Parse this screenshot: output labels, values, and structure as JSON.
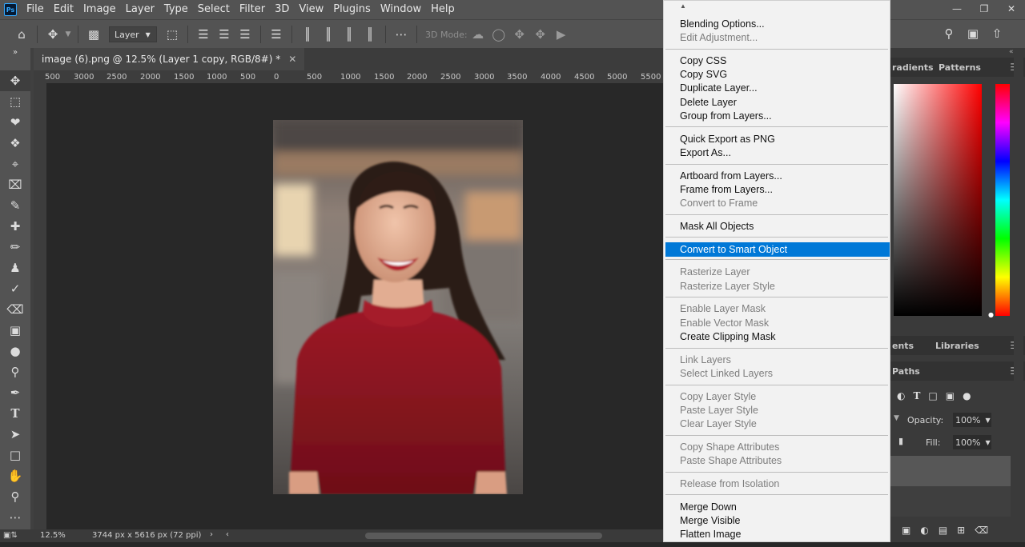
{
  "app": {
    "logo_text": "Ps"
  },
  "menubar": {
    "items": [
      "File",
      "Edit",
      "Image",
      "Layer",
      "Type",
      "Select",
      "Filter",
      "3D",
      "View",
      "Plugins",
      "Window",
      "Help"
    ]
  },
  "options": {
    "layer_select": "Layer",
    "three_d_label": "3D Mode:"
  },
  "document": {
    "tab_title": "image (6).png @ 12.5% (Layer 1 copy, RGB/8#) *"
  },
  "ruler": {
    "ticks": [
      "500",
      "3000",
      "2500",
      "2000",
      "1500",
      "1000",
      "500",
      "0",
      "500",
      "1000",
      "1500",
      "2000",
      "2500",
      "3000",
      "3500",
      "4000",
      "4500",
      "5000",
      "5500"
    ]
  },
  "status": {
    "zoom": "12.5%",
    "doc_info": "3744 px x 5616 px (72 ppi)"
  },
  "panels": {
    "color_tabs": [
      "radients",
      "Patterns"
    ],
    "mid_tabs": [
      "ents",
      "Libraries"
    ],
    "layers_tab": "Paths",
    "opacity_label": "Opacity:",
    "opacity_value": "100%",
    "fill_label": "Fill:",
    "fill_value": "100%"
  },
  "context_menu": {
    "highlighted": "Convert to Smart Object",
    "groups": [
      [
        {
          "label": "Blending Options...",
          "enabled": true
        },
        {
          "label": "Edit Adjustment...",
          "enabled": false
        }
      ],
      [
        {
          "label": "Copy CSS",
          "enabled": true
        },
        {
          "label": "Copy SVG",
          "enabled": true
        },
        {
          "label": "Duplicate Layer...",
          "enabled": true
        },
        {
          "label": "Delete Layer",
          "enabled": true
        },
        {
          "label": "Group from Layers...",
          "enabled": true
        }
      ],
      [
        {
          "label": "Quick Export as PNG",
          "enabled": true
        },
        {
          "label": "Export As...",
          "enabled": true
        }
      ],
      [
        {
          "label": "Artboard from Layers...",
          "enabled": true
        },
        {
          "label": "Frame from Layers...",
          "enabled": true
        },
        {
          "label": "Convert to Frame",
          "enabled": false
        }
      ],
      [
        {
          "label": "Mask All Objects",
          "enabled": true
        }
      ],
      [
        {
          "label": "Convert to Smart Object",
          "enabled": true
        }
      ],
      [
        {
          "label": "Rasterize Layer",
          "enabled": false
        },
        {
          "label": "Rasterize Layer Style",
          "enabled": false
        }
      ],
      [
        {
          "label": "Enable Layer Mask",
          "enabled": false
        },
        {
          "label": "Enable Vector Mask",
          "enabled": false
        },
        {
          "label": "Create Clipping Mask",
          "enabled": true
        }
      ],
      [
        {
          "label": "Link Layers",
          "enabled": false
        },
        {
          "label": "Select Linked Layers",
          "enabled": false
        }
      ],
      [
        {
          "label": "Copy Layer Style",
          "enabled": false
        },
        {
          "label": "Paste Layer Style",
          "enabled": false
        },
        {
          "label": "Clear Layer Style",
          "enabled": false
        }
      ],
      [
        {
          "label": "Copy Shape Attributes",
          "enabled": false
        },
        {
          "label": "Paste Shape Attributes",
          "enabled": false
        }
      ],
      [
        {
          "label": "Release from Isolation",
          "enabled": false
        }
      ],
      [
        {
          "label": "Merge Down",
          "enabled": true
        },
        {
          "label": "Merge Visible",
          "enabled": true
        },
        {
          "label": "Flatten Image",
          "enabled": true
        }
      ]
    ]
  },
  "colors": {
    "highlight": "#0078d7",
    "photo_sweater": "#8e1420"
  }
}
